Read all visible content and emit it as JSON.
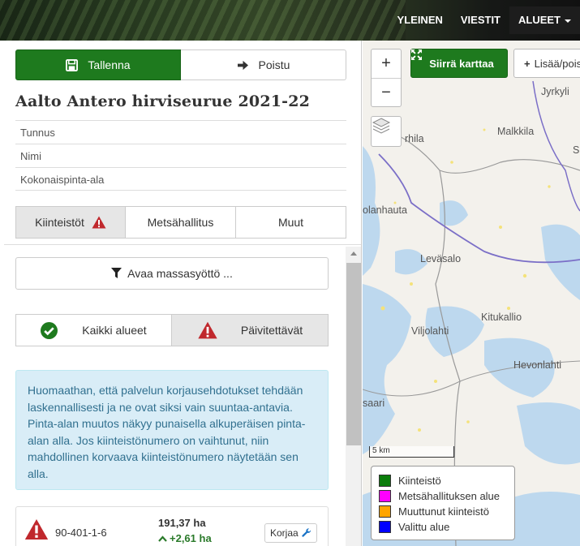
{
  "navbar": {
    "items": [
      {
        "label": "YLEINEN"
      },
      {
        "label": "VIESTIT"
      },
      {
        "label": "ALUEET"
      }
    ]
  },
  "panel": {
    "save_label": "Tallenna",
    "remove_label": "Poistu",
    "title": "Aalto Antero hirviseurue 2021-22",
    "fields": {
      "tunnus": "Tunnus",
      "nimi": "Nimi",
      "kokonaispinta_ala": "Kokonaispinta-ala"
    },
    "tabs": [
      {
        "label": "Kiinteistöt"
      },
      {
        "label": "Metsähallitus"
      },
      {
        "label": "Muut"
      }
    ],
    "mass_input_label": "Avaa massasyöttö ...",
    "filters": {
      "all_label": "Kaikki alueet",
      "updatable_label": "Päivitettävät"
    },
    "info_text": "Huomaathan, että palvelun korjausehdotukset tehdään laskennallisesti ja ne ovat siksi vain suuntaa-antavia. Pinta-alan muutos näkyy punaisella alkuperäisen pinta-alan alla. Jos kiinteistönumero on vaihtunut, niin mahdollinen korvaava kiinteistönumero näytetään sen alla.",
    "rows": [
      {
        "id": "90-401-1-6",
        "area": "191,37 ha",
        "change": "+2,61 ha",
        "fix_label": "Korjaa"
      }
    ]
  },
  "map": {
    "zoom_in": "+",
    "zoom_out": "−",
    "move_label": "Siirrä karttaa",
    "add_label": "Lisää/poista",
    "place_names": {
      "jyrkyli": "Jyrkyli",
      "malkkila": "Malkkila",
      "rhila": "rhila",
      "s": "S",
      "olanhauta": "olanhauta",
      "levasalo": "Leväsalo",
      "kitukallio": "Kitukallio",
      "viljolahti": "Viljolahti",
      "hevonlahti": "Hevonlahti",
      "saari": "saari"
    },
    "scale_label": "5 km",
    "legend": [
      {
        "label": "Kiinteistö",
        "color": "#0a7d0a"
      },
      {
        "label": "Metsähallituksen alue",
        "color": "#ff00ff"
      },
      {
        "label": "Muuttunut kiinteistö",
        "color": "#ffa500"
      },
      {
        "label": "Valittu alue",
        "color": "#0000ff"
      }
    ]
  },
  "colors": {
    "brand_green": "#1e7a1e",
    "warning_red": "#c0282d",
    "info_bg": "#d9edf7",
    "info_text": "#31708f",
    "success_green": "#2a7a2a"
  }
}
